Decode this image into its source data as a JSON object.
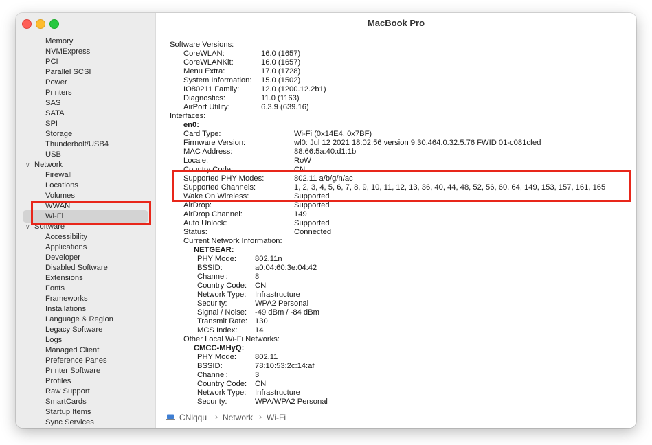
{
  "window": {
    "title": "MacBook Pro"
  },
  "sidebar": {
    "items": [
      {
        "label": "Memory",
        "kind": "child",
        "selected": false
      },
      {
        "label": "NVMExpress",
        "kind": "child",
        "selected": false
      },
      {
        "label": "PCI",
        "kind": "child",
        "selected": false
      },
      {
        "label": "Parallel SCSI",
        "kind": "child",
        "selected": false
      },
      {
        "label": "Power",
        "kind": "child",
        "selected": false
      },
      {
        "label": "Printers",
        "kind": "child",
        "selected": false
      },
      {
        "label": "SAS",
        "kind": "child",
        "selected": false
      },
      {
        "label": "SATA",
        "kind": "child",
        "selected": false
      },
      {
        "label": "SPI",
        "kind": "child",
        "selected": false
      },
      {
        "label": "Storage",
        "kind": "child",
        "selected": false
      },
      {
        "label": "Thunderbolt/USB4",
        "kind": "child",
        "selected": false
      },
      {
        "label": "USB",
        "kind": "child",
        "selected": false
      },
      {
        "label": "Network",
        "kind": "group",
        "selected": false
      },
      {
        "label": "Firewall",
        "kind": "child",
        "selected": false
      },
      {
        "label": "Locations",
        "kind": "child",
        "selected": false
      },
      {
        "label": "Volumes",
        "kind": "child",
        "selected": false
      },
      {
        "label": "WWAN",
        "kind": "child",
        "selected": false
      },
      {
        "label": "Wi-Fi",
        "kind": "child",
        "selected": true
      },
      {
        "label": "Software",
        "kind": "group",
        "selected": false
      },
      {
        "label": "Accessibility",
        "kind": "child",
        "selected": false
      },
      {
        "label": "Applications",
        "kind": "child",
        "selected": false
      },
      {
        "label": "Developer",
        "kind": "child",
        "selected": false
      },
      {
        "label": "Disabled Software",
        "kind": "child",
        "selected": false
      },
      {
        "label": "Extensions",
        "kind": "child",
        "selected": false
      },
      {
        "label": "Fonts",
        "kind": "child",
        "selected": false
      },
      {
        "label": "Frameworks",
        "kind": "child",
        "selected": false
      },
      {
        "label": "Installations",
        "kind": "child",
        "selected": false
      },
      {
        "label": "Language & Region",
        "kind": "child",
        "selected": false
      },
      {
        "label": "Legacy Software",
        "kind": "child",
        "selected": false
      },
      {
        "label": "Logs",
        "kind": "child",
        "selected": false
      },
      {
        "label": "Managed Client",
        "kind": "child",
        "selected": false
      },
      {
        "label": "Preference Panes",
        "kind": "child",
        "selected": false
      },
      {
        "label": "Printer Software",
        "kind": "child",
        "selected": false
      },
      {
        "label": "Profiles",
        "kind": "child",
        "selected": false
      },
      {
        "label": "Raw Support",
        "kind": "child",
        "selected": false
      },
      {
        "label": "SmartCards",
        "kind": "child",
        "selected": false
      },
      {
        "label": "Startup Items",
        "kind": "child",
        "selected": false
      },
      {
        "label": "Sync Services",
        "kind": "child",
        "selected": false
      }
    ]
  },
  "content": {
    "lines": [
      {
        "key": "Software Versions:",
        "value": "",
        "level": 0,
        "bold": false
      },
      {
        "key": "CoreWLAN:",
        "value": "16.0 (1657)",
        "level": 1,
        "bold": false
      },
      {
        "key": "CoreWLANKit:",
        "value": "16.0 (1657)",
        "level": 1,
        "bold": false
      },
      {
        "key": "Menu Extra:",
        "value": "17.0 (1728)",
        "level": 1,
        "bold": false
      },
      {
        "key": "System Information:",
        "value": "15.0 (1502)",
        "level": 1,
        "bold": false
      },
      {
        "key": "IO80211 Family:",
        "value": "12.0 (1200.12.2b1)",
        "level": 1,
        "bold": false
      },
      {
        "key": "Diagnostics:",
        "value": "11.0 (1163)",
        "level": 1,
        "bold": false
      },
      {
        "key": "AirPort Utility:",
        "value": "6.3.9 (639.16)",
        "level": 1,
        "bold": false
      },
      {
        "key": "Interfaces:",
        "value": "",
        "level": 0,
        "bold": false
      },
      {
        "key": "en0:",
        "value": "",
        "level": 1,
        "bold": true
      },
      {
        "key": "Card Type:",
        "value": "Wi-Fi  (0x14E4, 0x7BF)",
        "level": 2,
        "bold": false
      },
      {
        "key": "Firmware Version:",
        "value": "wl0: Jul 12 2021 18:02:56 version 9.30.464.0.32.5.76 FWID 01-c081cfed",
        "level": 2,
        "bold": false
      },
      {
        "key": "MAC Address:",
        "value": "88:66:5a:40:d1:1b",
        "level": 2,
        "bold": false
      },
      {
        "key": "Locale:",
        "value": "RoW",
        "level": 2,
        "bold": false
      },
      {
        "key": "Country Code:",
        "value": "CN",
        "level": 2,
        "bold": false
      },
      {
        "key": "Supported PHY Modes:",
        "value": "802.11 a/b/g/n/ac",
        "level": 2,
        "bold": false
      },
      {
        "key": "Supported Channels:",
        "value": "1, 2, 3, 4, 5, 6, 7, 8, 9, 10, 11, 12, 13, 36, 40, 44, 48, 52, 56, 60, 64, 149, 153, 157, 161, 165",
        "level": 2,
        "bold": false
      },
      {
        "key": "Wake On Wireless:",
        "value": "Supported",
        "level": 2,
        "bold": false
      },
      {
        "key": "AirDrop:",
        "value": "Supported",
        "level": 2,
        "bold": false
      },
      {
        "key": "AirDrop Channel:",
        "value": "149",
        "level": 2,
        "bold": false
      },
      {
        "key": "Auto Unlock:",
        "value": "Supported",
        "level": 2,
        "bold": false
      },
      {
        "key": "Status:",
        "value": "Connected",
        "level": 2,
        "bold": false
      },
      {
        "key": "Current Network Information:",
        "value": "",
        "level": 2,
        "bold": false
      },
      {
        "key": "NETGEAR:",
        "value": "",
        "level": 3,
        "bold": true
      },
      {
        "key": "PHY Mode:",
        "value": "802.11n",
        "level": 4,
        "bold": false
      },
      {
        "key": "BSSID:",
        "value": "a0:04:60:3e:04:42",
        "level": 4,
        "bold": false
      },
      {
        "key": "Channel:",
        "value": "8",
        "level": 4,
        "bold": false
      },
      {
        "key": "Country Code:",
        "value": "CN",
        "level": 4,
        "bold": false
      },
      {
        "key": "Network Type:",
        "value": "Infrastructure",
        "level": 4,
        "bold": false
      },
      {
        "key": "Security:",
        "value": "WPA2 Personal",
        "level": 4,
        "bold": false
      },
      {
        "key": "Signal / Noise:",
        "value": "-49 dBm / -84 dBm",
        "level": 4,
        "bold": false
      },
      {
        "key": "Transmit Rate:",
        "value": "130",
        "level": 4,
        "bold": false
      },
      {
        "key": "MCS Index:",
        "value": "14",
        "level": 4,
        "bold": false
      },
      {
        "key": "Other Local Wi-Fi Networks:",
        "value": "",
        "level": 2,
        "bold": false
      },
      {
        "key": "CMCC-MHyQ:",
        "value": "",
        "level": 3,
        "bold": true
      },
      {
        "key": "PHY Mode:",
        "value": "802.11",
        "level": 4,
        "bold": false
      },
      {
        "key": "BSSID:",
        "value": "78:10:53:2c:14:af",
        "level": 4,
        "bold": false
      },
      {
        "key": "Channel:",
        "value": "3",
        "level": 4,
        "bold": false
      },
      {
        "key": "Country Code:",
        "value": "CN",
        "level": 4,
        "bold": false
      },
      {
        "key": "Network Type:",
        "value": "Infrastructure",
        "level": 4,
        "bold": false
      },
      {
        "key": "Security:",
        "value": "WPA/WPA2 Personal",
        "level": 4,
        "bold": false
      }
    ]
  },
  "statusbar": {
    "crumbs": [
      "CNlqqu",
      "Network",
      "Wi-Fi"
    ],
    "separator": "›"
  },
  "colors": {
    "highlight_box": "#e8261a",
    "sidebar_bg": "#ececec",
    "selection_bg": "#d3d3d3"
  },
  "icons": {
    "laptop": "laptop-icon",
    "chevron": "chevron-down-icon"
  }
}
